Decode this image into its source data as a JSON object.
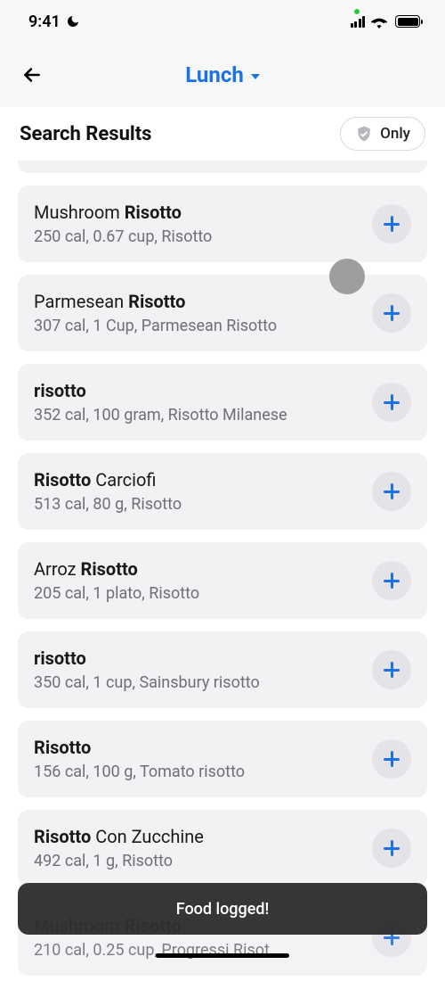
{
  "status": {
    "time": "9:41"
  },
  "header": {
    "title": "Lunch"
  },
  "section": {
    "title": "Search Results",
    "only_label": "Only"
  },
  "toast": {
    "message": "Food logged!"
  },
  "results": [
    {
      "title_pre": "Mushroom ",
      "title_bold": "Risotto",
      "title_post": "",
      "sub": "250 cal, 0.67 cup, Risotto"
    },
    {
      "title_pre": "Parmesean ",
      "title_bold": "Risotto",
      "title_post": "",
      "sub": "307 cal, 1 Cup, Parmesean Risotto"
    },
    {
      "title_pre": "",
      "title_bold": "risotto",
      "title_post": "",
      "sub": "352 cal, 100 gram, Risotto Milanese"
    },
    {
      "title_pre": "",
      "title_bold": "Risotto",
      "title_post": " Carciofi",
      "sub": "513 cal, 80 g, Risotto"
    },
    {
      "title_pre": "Arroz ",
      "title_bold": "Risotto",
      "title_post": "",
      "sub": "205 cal, 1 plato, Risotto"
    },
    {
      "title_pre": "",
      "title_bold": "risotto",
      "title_post": "",
      "sub": "350 cal, 1 cup, Sainsbury risotto"
    },
    {
      "title_pre": "",
      "title_bold": "Risotto",
      "title_post": "",
      "sub": "156 cal, 100 g, Tomato risotto"
    },
    {
      "title_pre": "",
      "title_bold": "Risotto",
      "title_post": " Con Zucchine",
      "sub": "492 cal, 1 g, Risotto"
    },
    {
      "title_pre": "Mushroom ",
      "title_bold": "Risotto",
      "title_post": "",
      "sub": "210 cal, 0.25 cup, Progressi Risot..."
    }
  ]
}
